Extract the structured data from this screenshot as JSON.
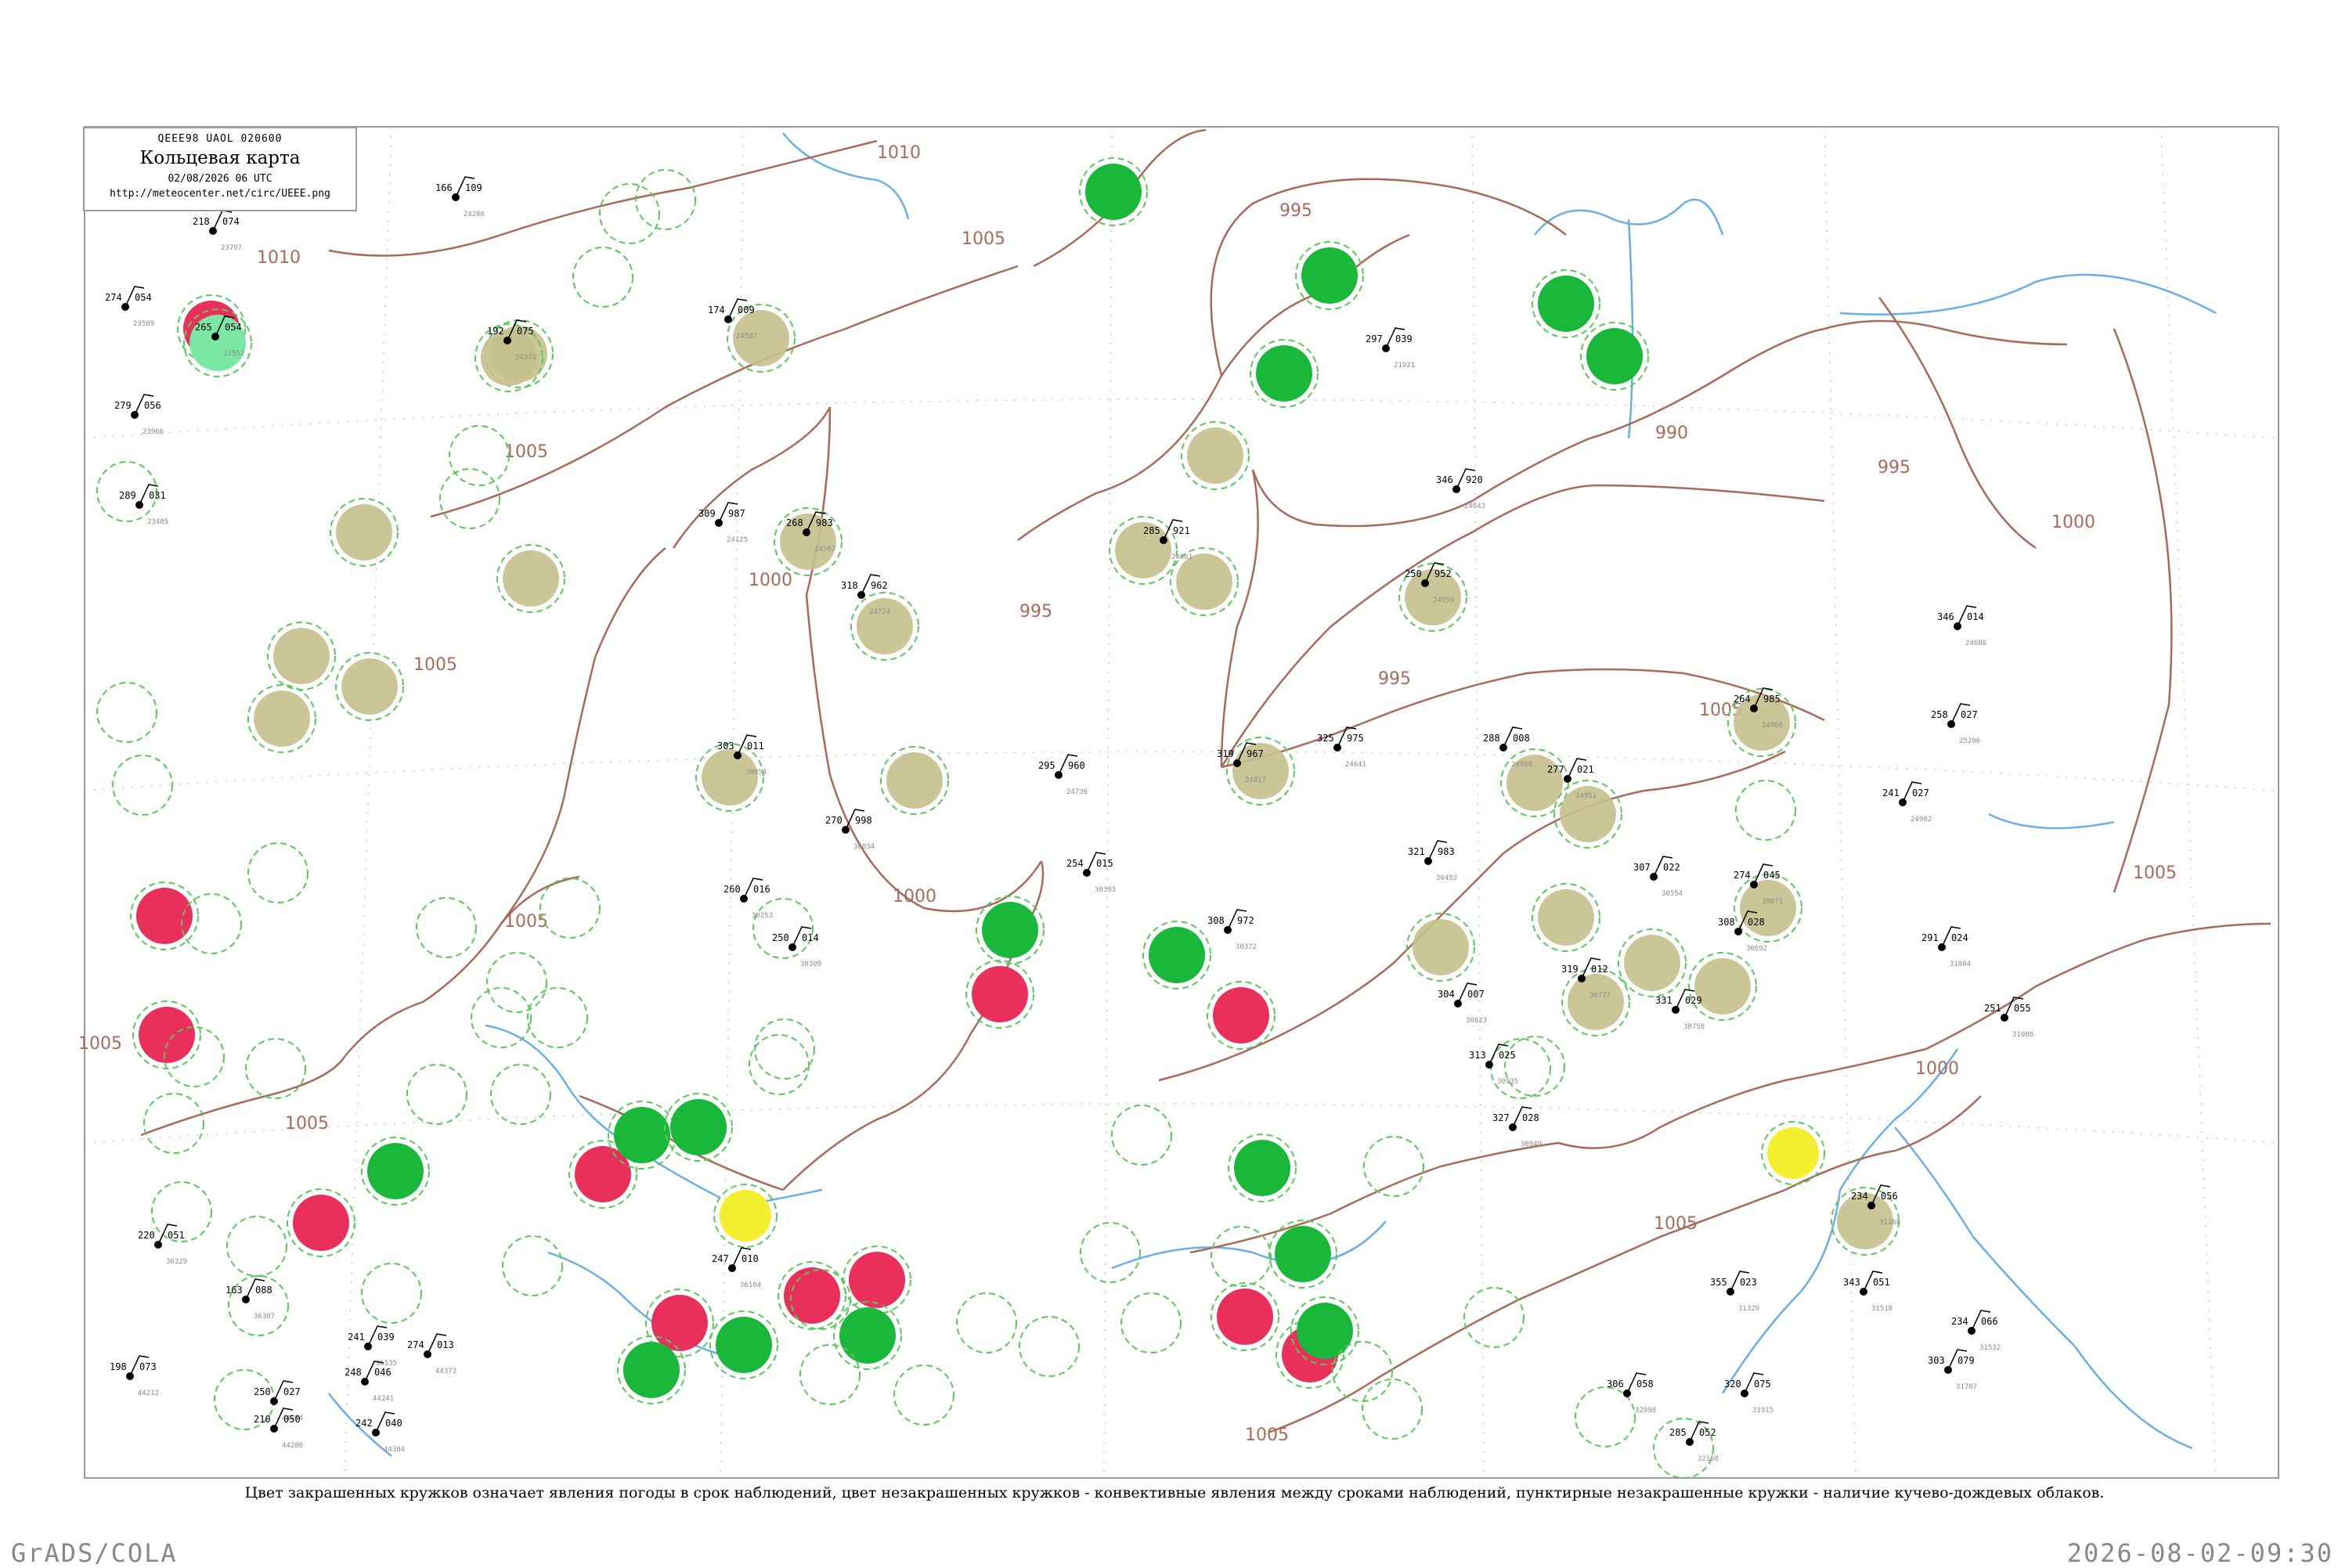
{
  "header": {
    "code": "QEEE98  UAOL  020600",
    "title": "Кольцевая карта",
    "date": "02/08/2026 06 UTC",
    "url": "http://meteocenter.net/circ/UEEE.png"
  },
  "isobars": {
    "labels": [
      "1010",
      "1005",
      "1005",
      "1005",
      "1005",
      "1005",
      "1000",
      "1000",
      "995",
      "995",
      "995",
      "995",
      "990",
      "1000",
      "1005",
      "1005",
      "1005",
      "1000",
      "1005",
      "1005",
      "1010"
    ]
  },
  "colors": {
    "isobar": "#a86a5a",
    "river": "#6aaee8",
    "frame": "#9a9a9a",
    "olive": "#c4c08c",
    "green": "#1ab83a",
    "red": "#e8305a",
    "yellow": "#f4f030",
    "lightgreen": "#7ae8a4",
    "dashed_green": "#5ac85a"
  },
  "stations": [
    {
      "id": "23552",
      "t": "265",
      "p": "054"
    },
    {
      "id": "23589",
      "t": "274",
      "p": "054"
    },
    {
      "id": "23405",
      "t": "289",
      "p": "031"
    },
    {
      "id": "23707",
      "t": "218",
      "p": "074"
    },
    {
      "id": "23966",
      "t": "279",
      "p": "056"
    },
    {
      "id": "24266",
      "t": "166",
      "p": "109"
    },
    {
      "id": "24507",
      "t": "174",
      "p": "009"
    },
    {
      "id": "21921",
      "t": "297",
      "p": "039"
    },
    {
      "id": "24125",
      "t": "309",
      "p": "987"
    },
    {
      "id": "24643",
      "t": "346",
      "p": "920"
    },
    {
      "id": "24371",
      "t": "192",
      "p": "075"
    },
    {
      "id": "24661",
      "t": "285",
      "p": "921"
    },
    {
      "id": "24959",
      "t": "250",
      "p": "952"
    },
    {
      "id": "24688",
      "t": "346",
      "p": "014"
    },
    {
      "id": "24507b",
      "t": "268",
      "p": "983"
    },
    {
      "id": "24724",
      "t": "318",
      "p": "962"
    },
    {
      "id": "24817",
      "t": "319",
      "p": "967"
    },
    {
      "id": "24641",
      "t": "325",
      "p": "975"
    },
    {
      "id": "24736",
      "t": "295",
      "p": "960"
    },
    {
      "id": "24908",
      "t": "288",
      "p": "008"
    },
    {
      "id": "24951",
      "t": "277",
      "p": "021"
    },
    {
      "id": "24966",
      "t": "264",
      "p": "985"
    },
    {
      "id": "25206",
      "t": "258",
      "p": "027"
    },
    {
      "id": "24982",
      "t": "241",
      "p": "027"
    },
    {
      "id": "30054",
      "t": "303",
      "p": "011"
    },
    {
      "id": "30253",
      "t": "260",
      "p": "016"
    },
    {
      "id": "30309",
      "t": "250",
      "p": "014"
    },
    {
      "id": "30393",
      "t": "254",
      "p": "015"
    },
    {
      "id": "30372",
      "t": "308",
      "p": "972"
    },
    {
      "id": "30493",
      "t": "321",
      "p": "983"
    },
    {
      "id": "30554",
      "t": "307",
      "p": "022"
    },
    {
      "id": "30673",
      "t": "274",
      "p": "045"
    },
    {
      "id": "30692",
      "t": "308",
      "p": "028"
    },
    {
      "id": "30758",
      "t": "331",
      "p": "029"
    },
    {
      "id": "30777",
      "t": "319",
      "p": "012"
    },
    {
      "id": "30823",
      "t": "304",
      "p": "007"
    },
    {
      "id": "30935",
      "t": "313",
      "p": "025"
    },
    {
      "id": "30949",
      "t": "327",
      "p": "028"
    },
    {
      "id": "31004",
      "t": "291",
      "p": "024"
    },
    {
      "id": "31088",
      "t": "251",
      "p": "055"
    },
    {
      "id": "31168",
      "t": "234",
      "p": "056"
    },
    {
      "id": "31329",
      "t": "355",
      "p": "023"
    },
    {
      "id": "31510",
      "t": "343",
      "p": "051"
    },
    {
      "id": "31532",
      "t": "234",
      "p": "066"
    },
    {
      "id": "31707",
      "t": "303",
      "p": "079"
    },
    {
      "id": "31915",
      "t": "320",
      "p": "075"
    },
    {
      "id": "32098",
      "t": "306",
      "p": "058"
    },
    {
      "id": "32150",
      "t": "285",
      "p": "052"
    },
    {
      "id": "36034",
      "t": "270",
      "p": "998"
    },
    {
      "id": "36104",
      "t": "247",
      "p": "010"
    },
    {
      "id": "36229",
      "t": "220",
      "p": "051"
    },
    {
      "id": "36307",
      "t": "163",
      "p": "088"
    },
    {
      "id": "36535",
      "t": "241",
      "p": "039"
    },
    {
      "id": "44212",
      "t": "198",
      "p": "073"
    },
    {
      "id": "44241",
      "t": "248",
      "p": "046"
    },
    {
      "id": "44284",
      "t": "250",
      "p": "027"
    },
    {
      "id": "44288",
      "t": "210",
      "p": "050"
    },
    {
      "id": "44304",
      "t": "242",
      "p": "040"
    },
    {
      "id": "44373",
      "t": "274",
      "p": "013"
    }
  ],
  "caption": "Цвет закрашенных кружков означает явления погоды в срок наблюдений, цвет незакрашенных кружков - конвективные явления между сроками наблюдений, пунктирные незакрашенные кружки - наличие кучево-дождевых облаков.",
  "footer": {
    "left": "GrADS/COLA",
    "right": "2026-08-02-09:30"
  }
}
